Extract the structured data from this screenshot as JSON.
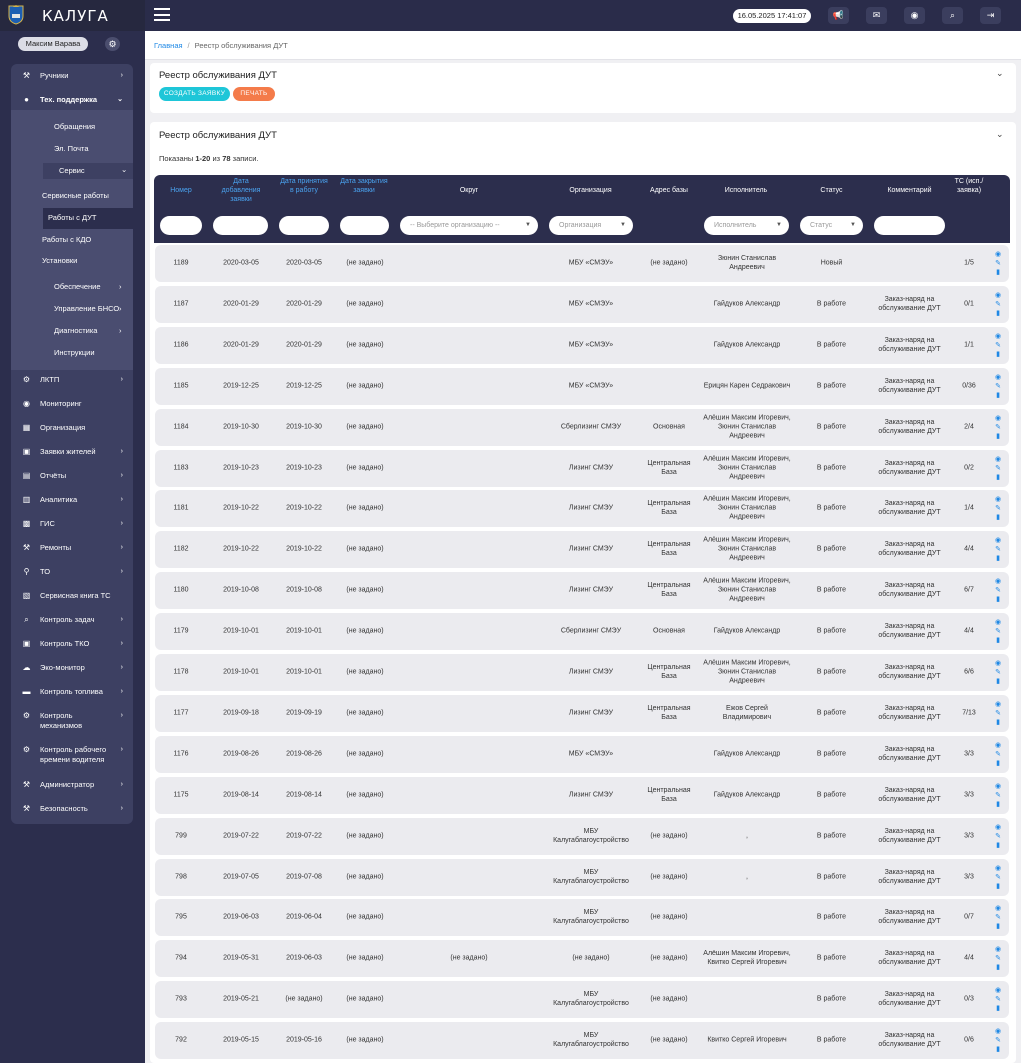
{
  "app": {
    "title": "КАЛУГА",
    "datetime": "16.05.2025 17:41:07"
  },
  "toolbar": {
    "icons": [
      "megaphone-icon",
      "mail-icon",
      "chat-icon",
      "search-icon",
      "logout-icon"
    ],
    "glyphs": [
      "✉",
      "✉",
      "◍",
      "⌕",
      "⇥"
    ]
  },
  "user": {
    "name": "Максим Варава"
  },
  "sidebar": {
    "items": [
      {
        "label": "Ручники",
        "icon": "wrench-icon"
      },
      {
        "label": "Тех. поддержка",
        "icon": "user-icon"
      },
      {
        "label": "Обращения"
      },
      {
        "label": "Эл. Почта"
      },
      {
        "label": "Сервис"
      },
      {
        "label": "Сервисные работы"
      },
      {
        "label": "Работы с ДУТ"
      },
      {
        "label": "Работы с КДО"
      },
      {
        "label": "Установки"
      },
      {
        "label": "Обеспечение"
      },
      {
        "label": "Управление БНСО"
      },
      {
        "label": "Диагностика"
      },
      {
        "label": "Инструкции"
      },
      {
        "label": "ЛКТП",
        "icon": "gear-icon"
      },
      {
        "label": "Мониторинг",
        "icon": "eye-icon"
      },
      {
        "label": "Организация",
        "icon": "building-icon"
      },
      {
        "label": "Заявки жителей",
        "icon": "truck-icon"
      },
      {
        "label": "Отчёты",
        "icon": "report-icon"
      },
      {
        "label": "Аналитика",
        "icon": "chart-icon"
      },
      {
        "label": "ГИС",
        "icon": "map-icon"
      },
      {
        "label": "Ремонты",
        "icon": "wrench-icon"
      },
      {
        "label": "ТО",
        "icon": "key-icon"
      },
      {
        "label": "Сервисная книга ТС",
        "icon": "book-icon"
      },
      {
        "label": "Контроль задач",
        "icon": "search-icon"
      },
      {
        "label": "Контроль ТКО",
        "icon": "truck-icon"
      },
      {
        "label": "Эко-монитор",
        "icon": "cloud-icon"
      },
      {
        "label": "Контроль топлива",
        "icon": "fuel-icon"
      },
      {
        "label": "Контроль механизмов",
        "icon": "gear-icon"
      },
      {
        "label": "Контроль рабочего времени водителя",
        "icon": "gear-icon"
      },
      {
        "label": "Администратор",
        "icon": "wrench-icon"
      },
      {
        "label": "Безопасность",
        "icon": "wrench-icon"
      }
    ]
  },
  "breadcrumb": {
    "home": "Главная",
    "separator": "/",
    "current": "Реестр обслуживания ДУТ"
  },
  "top_card": {
    "title": "Реестр обслуживания ДУТ",
    "create_label": "СОЗДАТЬ ЗАЯВКУ",
    "print_label": "ПЕЧАТЬ"
  },
  "table_card": {
    "title": "Реестр обслуживания ДУТ",
    "shown_prefix": "Показаны",
    "shown_range": "1-20",
    "shown_of": "из",
    "shown_total": "78",
    "shown_suffix": "записи."
  },
  "table": {
    "columns": [
      "Номер",
      "Дата добавления заявки",
      "Дата принятия в работу",
      "Дата закрытия заявки",
      "Округ",
      "Организация",
      "Адрес базы",
      "Исполнитель",
      "Статус",
      "Комментарий",
      "ТС (исп./заявка)"
    ],
    "filters": {
      "okrug": "-- Выберите организацию --",
      "org": "Организация",
      "executor": "Исполнитель",
      "status": "Статус"
    },
    "rows": [
      [
        "1189",
        "2020-03-05",
        "2020-03-05",
        "(не задано)",
        "",
        "МБУ «СМЭУ»",
        "(не задано)",
        "Зюнин Станислав Андреевич",
        "Новый",
        "",
        "1/5"
      ],
      [
        "1187",
        "2020-01-29",
        "2020-01-29",
        "(не задано)",
        "",
        "МБУ «СМЭУ»",
        "",
        "Гайдуков Александр",
        "В работе",
        "Заказ-наряд на обслуживание ДУТ",
        "0/1"
      ],
      [
        "1186",
        "2020-01-29",
        "2020-01-29",
        "(не задано)",
        "",
        "МБУ «СМЭУ»",
        "",
        "Гайдуков Александр",
        "В работе",
        "Заказ-наряд на обслуживание ДУТ",
        "1/1"
      ],
      [
        "1185",
        "2019-12-25",
        "2019-12-25",
        "(не задано)",
        "",
        "МБУ «СМЭУ»",
        "",
        "Ерицян Карен Седракович",
        "В работе",
        "Заказ-наряд на обслуживание ДУТ",
        "0/36"
      ],
      [
        "1184",
        "2019-10-30",
        "2019-10-30",
        "(не задано)",
        "",
        "Сберлизинг СМЭУ",
        "Основная",
        "Алёшин Максим Игоревич, Зюнин Станислав Андреевич",
        "В работе",
        "Заказ-наряд на обслуживание ДУТ",
        "2/4"
      ],
      [
        "1183",
        "2019-10-23",
        "2019-10-23",
        "(не задано)",
        "",
        "Лизинг СМЭУ",
        "Центральная База",
        "Алёшин Максим Игоревич, Зюнин Станислав Андреевич",
        "В работе",
        "Заказ-наряд на обслуживание ДУТ",
        "0/2"
      ],
      [
        "1181",
        "2019-10-22",
        "2019-10-22",
        "(не задано)",
        "",
        "Лизинг СМЭУ",
        "Центральная База",
        "Алёшин Максим Игоревич, Зюнин Станислав Андреевич",
        "В работе",
        "Заказ-наряд на обслуживание ДУТ",
        "1/4"
      ],
      [
        "1182",
        "2019-10-22",
        "2019-10-22",
        "(не задано)",
        "",
        "Лизинг СМЭУ",
        "Центральная База",
        "Алёшин Максим Игоревич, Зюнин Станислав Андреевич",
        "В работе",
        "Заказ-наряд на обслуживание ДУТ",
        "4/4"
      ],
      [
        "1180",
        "2019-10-08",
        "2019-10-08",
        "(не задано)",
        "",
        "Лизинг СМЭУ",
        "Центральная База",
        "Алёшин Максим Игоревич, Зюнин Станислав Андреевич",
        "В работе",
        "Заказ-наряд на обслуживание ДУТ",
        "6/7"
      ],
      [
        "1179",
        "2019-10-01",
        "2019-10-01",
        "(не задано)",
        "",
        "Сберлизинг СМЭУ",
        "Основная",
        "Гайдуков Александр",
        "В работе",
        "Заказ-наряд на обслуживание ДУТ",
        "4/4"
      ],
      [
        "1178",
        "2019-10-01",
        "2019-10-01",
        "(не задано)",
        "",
        "Лизинг СМЭУ",
        "Центральная База",
        "Алёшин Максим Игоревич, Зюнин Станислав Андреевич",
        "В работе",
        "Заказ-наряд на обслуживание ДУТ",
        "6/6"
      ],
      [
        "1177",
        "2019-09-18",
        "2019-09-19",
        "(не задано)",
        "",
        "Лизинг СМЭУ",
        "Центральная База",
        "Ежов Сергей Владимирович",
        "В работе",
        "Заказ-наряд на обслуживание ДУТ",
        "7/13"
      ],
      [
        "1176",
        "2019-08-26",
        "2019-08-26",
        "(не задано)",
        "",
        "МБУ «СМЭУ»",
        "",
        "Гайдуков Александр",
        "В работе",
        "Заказ-наряд на обслуживание ДУТ",
        "3/3"
      ],
      [
        "1175",
        "2019-08-14",
        "2019-08-14",
        "(не задано)",
        "",
        "Лизинг СМЭУ",
        "Центральная База",
        "Гайдуков Александр",
        "В работе",
        "Заказ-наряд на обслуживание ДУТ",
        "3/3"
      ],
      [
        "799",
        "2019-07-22",
        "2019-07-22",
        "(не задано)",
        "",
        "МБУ Калугаблагоустройство",
        "(не задано)",
        ",",
        "В работе",
        "Заказ-наряд на обслуживание ДУТ",
        "3/3"
      ],
      [
        "798",
        "2019-07-05",
        "2019-07-08",
        "(не задано)",
        "",
        "МБУ Калугаблагоустройство",
        "(не задано)",
        ",",
        "В работе",
        "Заказ-наряд на обслуживание ДУТ",
        "3/3"
      ],
      [
        "795",
        "2019-06-03",
        "2019-06-04",
        "(не задано)",
        "",
        "МБУ Калугаблагоустройство",
        "(не задано)",
        "",
        "В работе",
        "Заказ-наряд на обслуживание ДУТ",
        "0/7"
      ],
      [
        "794",
        "2019-05-31",
        "2019-06-03",
        "(не задано)",
        "(не задано)",
        "(не задано)",
        "(не задано)",
        "Алёшин Максим Игоревич, Квитко Сергей Игоревич",
        "В работе",
        "Заказ-наряд на обслуживание ДУТ",
        "4/4"
      ],
      [
        "793",
        "2019-05-21",
        "(не задано)",
        "(не задано)",
        "",
        "МБУ Калугаблагоустройство",
        "(не задано)",
        "",
        "В работе",
        "Заказ-наряд на обслуживание ДУТ",
        "0/3"
      ],
      [
        "792",
        "2019-05-15",
        "2019-05-16",
        "(не задано)",
        "",
        "МБУ Калугаблагоустройство",
        "(не задано)",
        "Квитко Сергей Игоревич",
        "В работе",
        "Заказ-наряд на обслуживание ДУТ",
        "0/6"
      ]
    ],
    "actions": {
      "view_glyph": "◉",
      "edit_glyph": "✎",
      "delete_glyph": "▮"
    }
  },
  "colors": {
    "topbar": "#2a2c4a",
    "sidebar": "#2c2e4d",
    "accent": "#1e88e5",
    "create": "#1ec6d8",
    "print": "#f47b4a"
  }
}
